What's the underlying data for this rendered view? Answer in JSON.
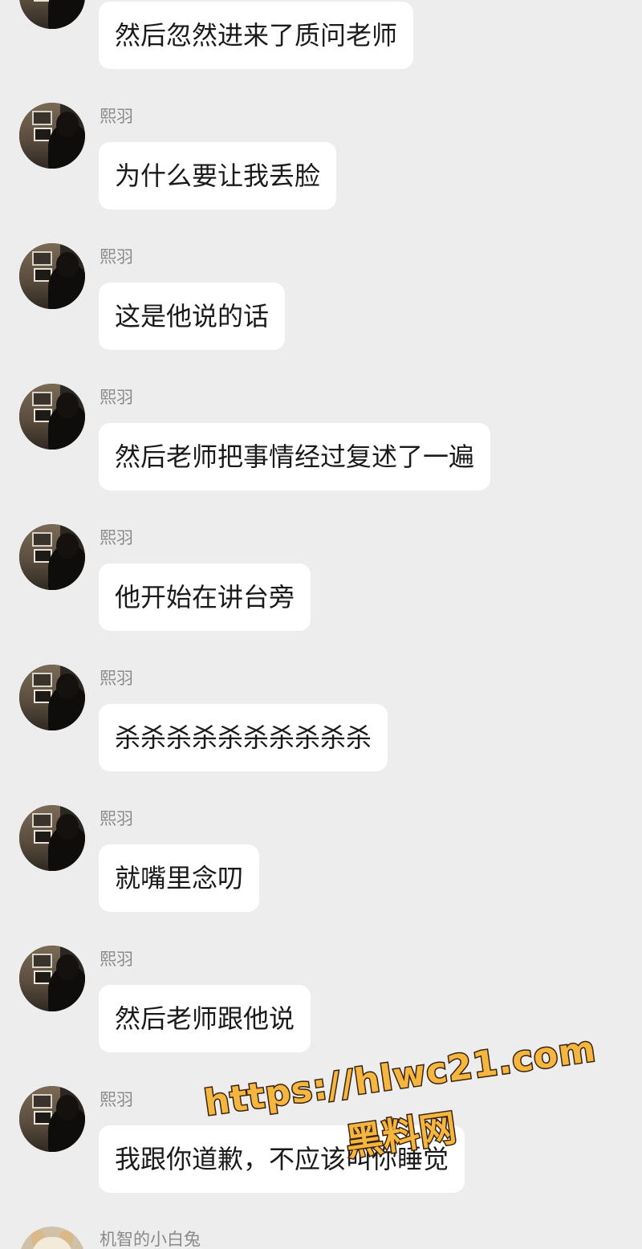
{
  "messages": [
    {
      "sender": "",
      "text": "然后忽然进来了质问老师"
    },
    {
      "sender": "熙羽",
      "text": "为什么要让我丢脸"
    },
    {
      "sender": "熙羽",
      "text": "这是他说的话"
    },
    {
      "sender": "熙羽",
      "text": "然后老师把事情经过复述了一遍"
    },
    {
      "sender": "熙羽",
      "text": "他开始在讲台旁"
    },
    {
      "sender": "熙羽",
      "text": "杀杀杀杀杀杀杀杀杀杀"
    },
    {
      "sender": "熙羽",
      "text": "就嘴里念叨"
    },
    {
      "sender": "熙羽",
      "text": "然后老师跟他说"
    },
    {
      "sender": "熙羽",
      "text": "我跟你道歉，不应该叫你睡觉"
    },
    {
      "sender": "机智的小白兔",
      "text": ""
    }
  ],
  "watermark": {
    "url": "https://hlwc21.com",
    "label": "黑料网"
  }
}
